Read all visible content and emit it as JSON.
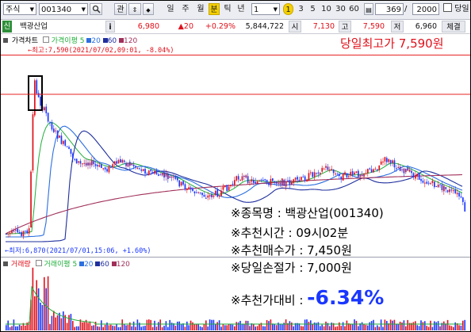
{
  "toolbar": {
    "market": "주식",
    "code": "001340",
    "btn_gwan": "관",
    "periods": [
      "일",
      "주",
      "월",
      "분",
      "틱",
      "년"
    ],
    "active_period": "분",
    "interval_value": "1",
    "quick_intervals": [
      "1",
      "3",
      "5",
      "10",
      "30",
      "60"
    ],
    "count_value": "369",
    "total_value": "2000",
    "checkbox_label": "당일"
  },
  "infobar": {
    "badge": "신",
    "stock_name": "백광산업",
    "info_button": "i",
    "price": "6,980",
    "change": "▲20",
    "change_pct": "+0.29%",
    "volume": "5,844,722",
    "open_label": "시",
    "open_value": "7,130",
    "high_label": "고",
    "high_value": "7,590",
    "low_label": "저",
    "low_value": "6,960",
    "trade_label": "체결"
  },
  "price_legend": {
    "title": "가격차트",
    "ma_title": "가격이평",
    "ma_periods": [
      "5",
      "20",
      "60",
      "120"
    ]
  },
  "volume_legend": {
    "title": "거래량",
    "ma_title": "거래이평",
    "ma_periods": [
      "5",
      "20",
      "60",
      "120"
    ]
  },
  "chart_marks": {
    "high_label": "최고:7,590(2021/07/02,09:01, -8.04%)",
    "low_label": "최저:6,870(2021/07/01,15:06, +1.60%)"
  },
  "annotation": {
    "headline": "당일최고가 7,590원",
    "lines": [
      "※종목명 : 백광산업(001340)",
      "※추천시간 : 09시02분",
      "※추천매수가 : 7,450원",
      "※당일손절가 : 7,000원"
    ],
    "compare_label": "※추천가대비 : ",
    "compare_value": "-6.34%"
  },
  "colors": {
    "up": "#e0101a",
    "down": "#1a37ff",
    "ma5": "#1fae3a",
    "ma20": "#2b6fe0",
    "ma60": "#1f2f9e",
    "ma120": "#a0305a",
    "highlight": "#e82323"
  }
}
